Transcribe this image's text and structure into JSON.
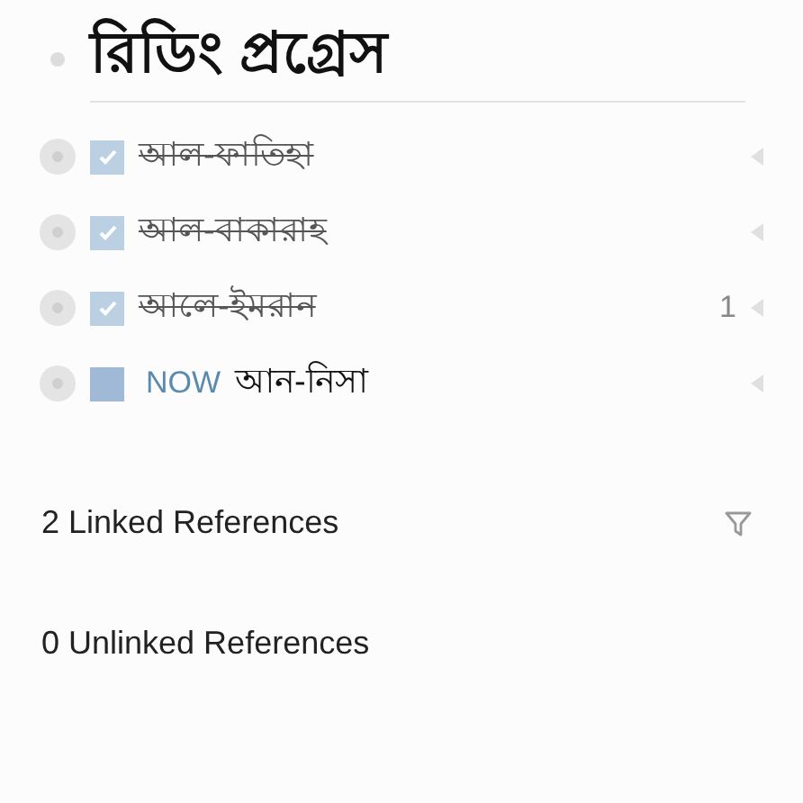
{
  "title": "রিডিং প্রগ্রেস",
  "items": [
    {
      "text": "আল-ফাতিহা",
      "checked": true
    },
    {
      "text": "আল-বাকারাহ",
      "checked": true
    },
    {
      "text": "আলে-ইমরান",
      "checked": true,
      "count": "1"
    },
    {
      "text": "আন-নিসা",
      "checked": false,
      "marker": "NOW"
    }
  ],
  "references": [
    {
      "label": "2 Linked References",
      "filter": true
    },
    {
      "label": "0 Unlinked References",
      "filter": false
    }
  ]
}
